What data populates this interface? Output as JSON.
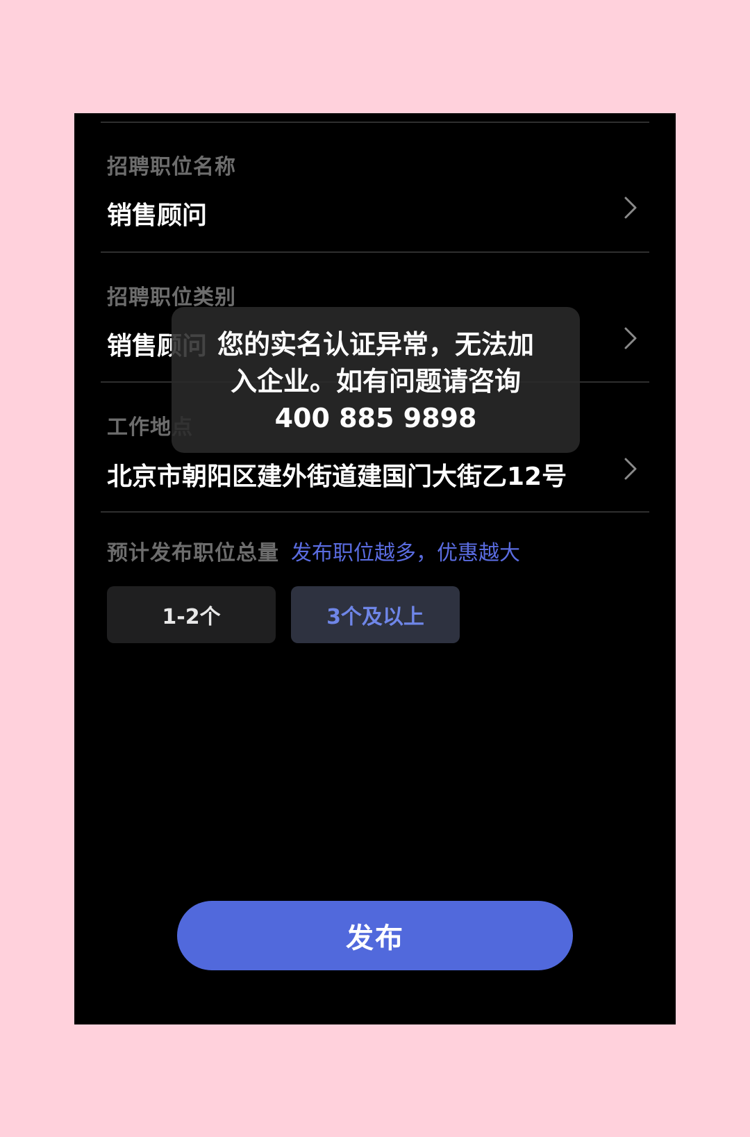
{
  "form": {
    "position_name": {
      "label": "招聘职位名称",
      "value": "销售顾问"
    },
    "position_category": {
      "label": "招聘职位类别",
      "value": "销售顾问"
    },
    "work_location": {
      "label": "工作地点",
      "value": "北京市朝阳区建外街道建国门大街乙12号"
    },
    "quantity": {
      "label": "预计发布职位总量",
      "promo": "发布职位越多，优惠越大",
      "options": [
        "1-2个",
        "3个及以上"
      ],
      "selected": "3个及以上"
    }
  },
  "publish_label": "发布",
  "toast": {
    "lines": [
      "您的实名认证异常，无法加",
      "入企业。如有问题请咨询",
      "400 885 9898"
    ]
  },
  "colors": {
    "page_background": "#ffd1dc",
    "screen_background": "#000000",
    "accent": "#5169dc",
    "promo_text": "#5a6ce0",
    "selected_option_text": "#6f86e8"
  }
}
